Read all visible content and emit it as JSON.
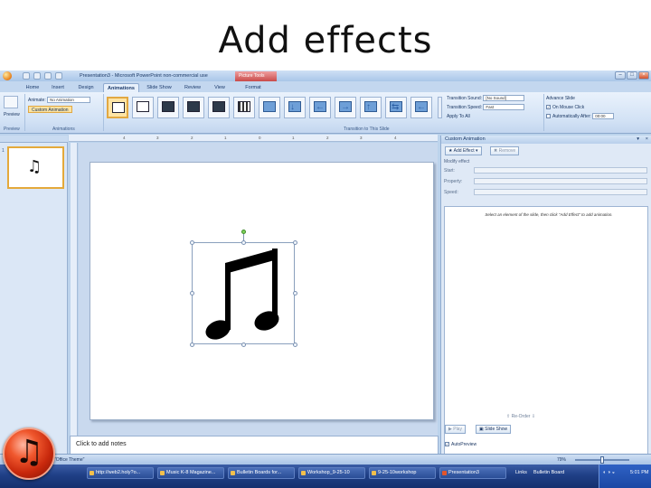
{
  "slide_title": "Add effects",
  "window": {
    "title": "Presentation3 - Microsoft PowerPoint non-commercial use",
    "contextual_tab": "Picture Tools"
  },
  "ribbon_tabs": [
    "Home",
    "Insert",
    "Design",
    "Animations",
    "Slide Show",
    "Review",
    "View",
    "Format"
  ],
  "ribbon": {
    "preview_label": "Preview",
    "animate_label": "Animate:",
    "animate_value": "No Animation",
    "custom_animation_label": "Custom Animation",
    "animations_group": "Animations",
    "transition_group": "Transition to This Slide",
    "transition_sound_label": "Transition Sound:",
    "transition_sound_value": "[No Sound]",
    "transition_speed_label": "Transition Speed:",
    "transition_speed_value": "Fast",
    "apply_all_label": "Apply To All",
    "advance_slide_label": "Advance Slide",
    "on_mouse_click_label": "On Mouse Click",
    "auto_after_label": "Automatically After:",
    "auto_after_value": "00:00"
  },
  "ruler_ticks": [
    "4",
    "3",
    "2",
    "1",
    "0",
    "1",
    "2",
    "3",
    "4"
  ],
  "slides_pane": {
    "slide_number": "1",
    "thumb_glyph": "♫"
  },
  "notes_placeholder": "Click to add notes",
  "task_pane": {
    "title": "Custom Animation",
    "add_effect_label": "Add Effect",
    "remove_label": "Remove",
    "modify_label": "Modify effect",
    "start_label": "Start:",
    "property_label": "Property:",
    "speed_label": "Speed:",
    "hint": "Select an element of the slide, then click \"Add Effect\" to add animation.",
    "reorder_label": "Re-Order",
    "play_label": "Play",
    "slide_show_label": "Slide Show",
    "autopreview_label": "AutoPreview"
  },
  "status": {
    "theme": "\"Office Theme\"",
    "zoom": "79%"
  },
  "taskbar": {
    "items": [
      "http://web2.holy?o...",
      "Music K-8 Magazine...",
      "Bulletin Boards for...",
      "Workshop_9-25-10",
      "9-25-10workshop",
      "Presentation3"
    ],
    "links_label": "Links",
    "bulletin_label": "Bulletin Board",
    "clock": "5:01 PM"
  },
  "colors": {
    "accent_orange": "#e4a93b",
    "taskbar_blue": "#1f3f86",
    "ribbon_blue": "#d2e2f5"
  }
}
